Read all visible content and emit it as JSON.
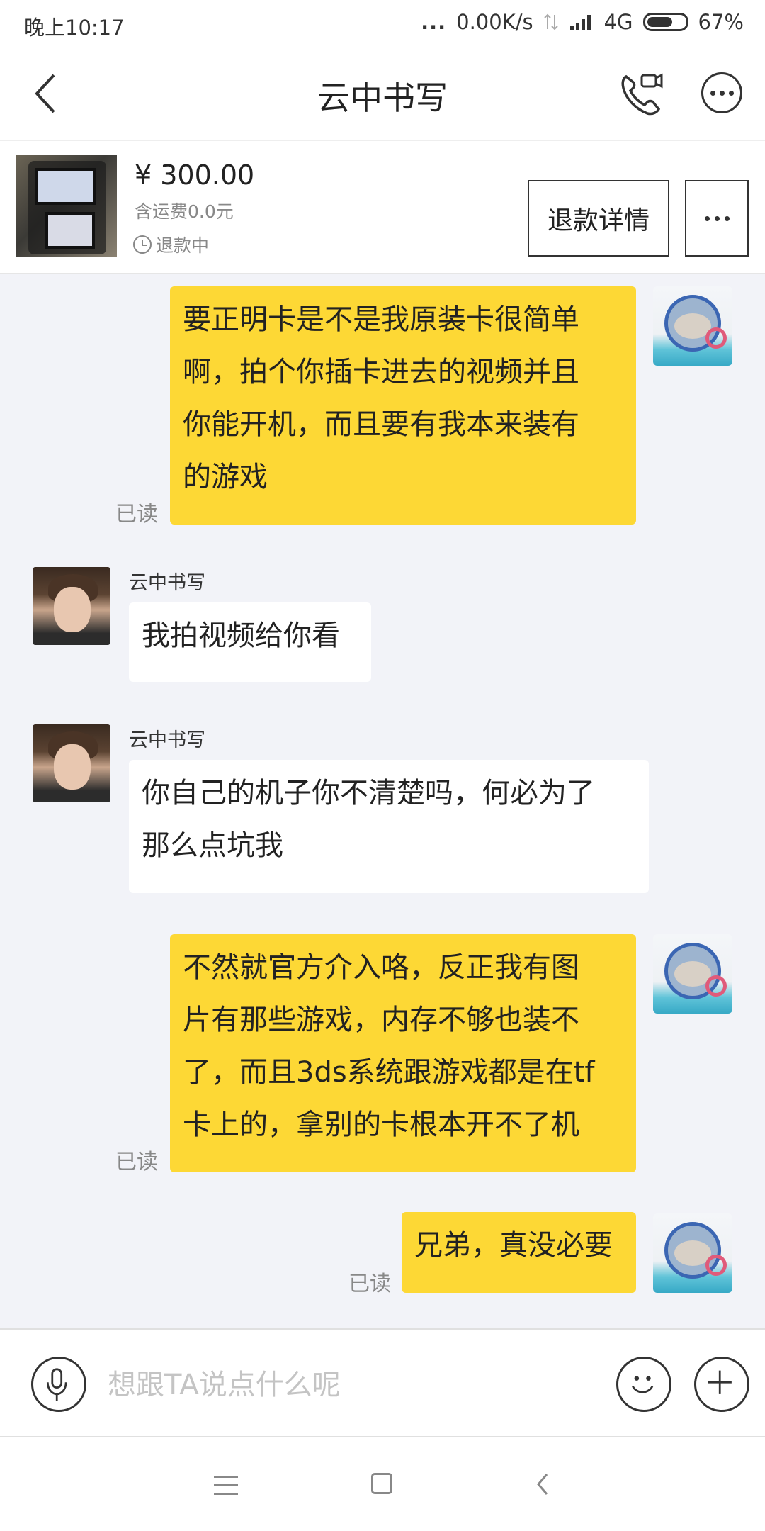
{
  "status_bar": {
    "time": "晚上10:17",
    "more": "...",
    "speed": "0.00K/s",
    "network": "4G",
    "battery": "67%",
    "battery_level": 0.67
  },
  "header": {
    "title": "云中书写",
    "back_icon": "chevron-left-icon",
    "call_icon": "phone-video-icon",
    "more_icon": "more-dots-icon"
  },
  "product": {
    "price": "¥ 300.00",
    "shipping": "含运费0.0元",
    "status": "退款中",
    "refund_details_label": "退款详情",
    "more_icon": "more-dots-icon"
  },
  "messages": [
    {
      "from": "me",
      "lines": [
        "要正明卡是不是我原装卡很简单",
        "啊，拍个你插卡进去的视频并且",
        "你能开机，而且要有我本来装有",
        "的游戏"
      ],
      "read": "已读"
    },
    {
      "from": "them",
      "sender": "云中书写",
      "lines": [
        "我拍视频给你看"
      ]
    },
    {
      "from": "them",
      "sender": "云中书写",
      "lines": [
        "你自己的机子你不清楚吗，何必为了",
        "那么点坑我"
      ]
    },
    {
      "from": "me",
      "lines": [
        "不然就官方介入咯，反正我有图",
        "片有那些游戏，内存不够也装不",
        "了，而且3ds系统跟游戏都是在tf",
        "卡上的，拿别的卡根本开不了机"
      ],
      "read": "已读"
    },
    {
      "from": "me",
      "lines": [
        "兄弟，真没必要"
      ],
      "read": "已读"
    }
  ],
  "input": {
    "placeholder": "想跟TA说点什么呢",
    "value": "",
    "voice_icon": "microphone-icon",
    "emoji_icon": "smiley-icon",
    "plus_icon": "plus-icon"
  },
  "system_nav": {
    "menu_icon": "menu-icon",
    "home_icon": "home-square-icon",
    "back_icon": "back-triangle-icon"
  }
}
